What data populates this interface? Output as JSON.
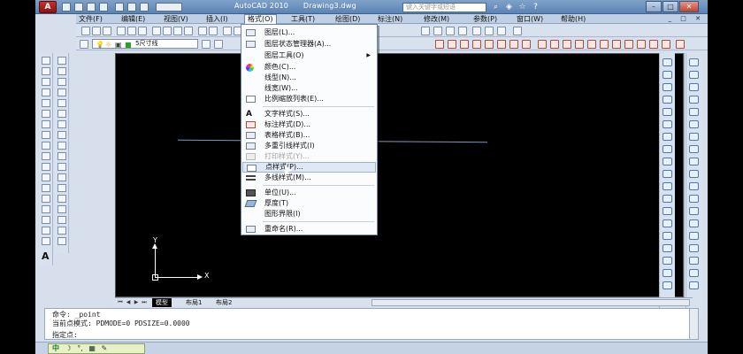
{
  "title_bar": {
    "app_name": "AutoCAD 2010",
    "document": "Drawing3.dwg",
    "logo_letter": "A",
    "qat_dropdown": "",
    "search_placeholder": "键入关键字或短语",
    "tools": [
      "search-icon",
      "star-icon",
      "help-icon"
    ]
  },
  "menubar": {
    "items": [
      {
        "label": "文件(F)",
        "name": "menu-file"
      },
      {
        "label": "编辑(E)",
        "name": "menu-edit"
      },
      {
        "label": "视图(V)",
        "name": "menu-view"
      },
      {
        "label": "插入(I)",
        "name": "menu-insert"
      },
      {
        "label": "格式(O)",
        "name": "menu-format",
        "active": true
      },
      {
        "label": "工具(T)",
        "name": "menu-tools"
      },
      {
        "label": "绘图(D)",
        "name": "menu-draw"
      },
      {
        "label": "标注(N)",
        "name": "menu-dimension"
      },
      {
        "label": "修改(M)",
        "name": "menu-modify"
      },
      {
        "label": "参数(P)",
        "name": "menu-parametric"
      },
      {
        "label": "窗口(W)",
        "name": "menu-window"
      },
      {
        "label": "帮助(H)",
        "name": "menu-help"
      }
    ]
  },
  "layer_toolbar": {
    "current_layer": "5尺寸线"
  },
  "format_menu": {
    "items": [
      {
        "label": "图层(L)...",
        "icon": "layer-icon"
      },
      {
        "label": "图层状态管理器(A)...",
        "icon": "layer-state-icon"
      },
      {
        "label": "图层工具(O)",
        "icon": "",
        "submenu": true
      },
      {
        "label": "颜色(C)...",
        "icon": "color-wheel-icon"
      },
      {
        "label": "线型(N)...",
        "icon": ""
      },
      {
        "label": "线宽(W)...",
        "icon": ""
      },
      {
        "label": "比例缩放列表(E)...",
        "icon": "scale-list-icon"
      },
      {
        "sep": true
      },
      {
        "label": "文字样式(S)...",
        "icon": "text-style-icon"
      },
      {
        "label": "标注样式(D)...",
        "icon": "dim-style-icon"
      },
      {
        "label": "表格样式(B)...",
        "icon": "table-style-icon"
      },
      {
        "label": "多重引线样式(I)",
        "icon": "mleader-style-icon"
      },
      {
        "label": "打印样式(Y)...",
        "icon": "plot-style-icon",
        "disabled": true
      },
      {
        "label": "点样式(P)...",
        "icon": "point-style-icon",
        "hover": true
      },
      {
        "label": "多线样式(M)...",
        "icon": "mline-style-icon"
      },
      {
        "sep": true
      },
      {
        "label": "单位(U)...",
        "icon": "units-icon"
      },
      {
        "label": "厚度(T)",
        "icon": "thickness-icon"
      },
      {
        "label": "图形界限(I)",
        "icon": ""
      },
      {
        "sep": true
      },
      {
        "label": "重命名(R)...",
        "icon": "rename-icon"
      }
    ]
  },
  "canvas": {
    "ucs_x": "X",
    "ucs_y": "Y"
  },
  "layout_tabs": [
    {
      "label": "模型",
      "active": true
    },
    {
      "label": "布局1"
    },
    {
      "label": "布局2"
    }
  ],
  "command": {
    "line1": "命令: _point",
    "line2": "当前点模式:  PDMODE=0  PDSIZE=0.0000",
    "prompt": "指定点:"
  },
  "ime": {
    "mode": "中",
    "glyphs": [
      "☽",
      "°,",
      "▦",
      "✎"
    ]
  },
  "colors": {
    "canvas": "#000000",
    "window": "#d6dfeb",
    "titlebar": "#5a84b6",
    "menu_hover": "#dfe9f6"
  }
}
